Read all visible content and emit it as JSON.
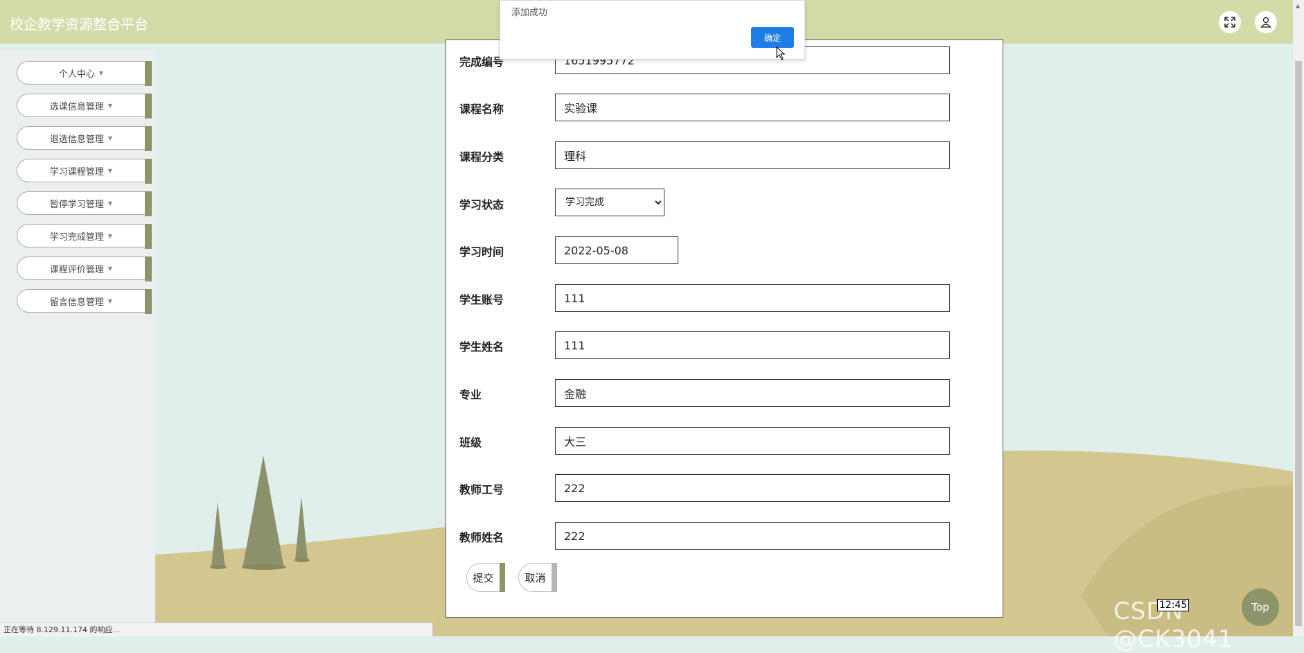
{
  "header": {
    "brand": "校企教学资源整合平台",
    "fullscreen_icon": "expand-arrows-icon",
    "user_icon": "user-icon"
  },
  "sidebar": {
    "items": [
      {
        "label": "个人中心"
      },
      {
        "label": "选课信息管理"
      },
      {
        "label": "退选信息管理"
      },
      {
        "label": "学习课程管理"
      },
      {
        "label": "暂停学习管理"
      },
      {
        "label": "学习完成管理"
      },
      {
        "label": "课程评价管理"
      },
      {
        "label": "留言信息管理"
      }
    ],
    "caret": "▼"
  },
  "form": {
    "completion_no": {
      "label": "完成编号",
      "value": "1651995772"
    },
    "course_name": {
      "label": "课程名称",
      "value": "实验课"
    },
    "course_category": {
      "label": "课程分类",
      "value": "理科"
    },
    "study_status": {
      "label": "学习状态",
      "value": "学习完成"
    },
    "study_time": {
      "label": "学习时间",
      "value": "2022-05-08"
    },
    "student_account": {
      "label": "学生账号",
      "value": "111"
    },
    "student_name": {
      "label": "学生姓名",
      "value": "111"
    },
    "major": {
      "label": "专业",
      "value": "金融"
    },
    "class": {
      "label": "班级",
      "value": "大三"
    },
    "teacher_no": {
      "label": "教师工号",
      "value": "222"
    },
    "teacher_name": {
      "label": "教师姓名",
      "value": "222"
    },
    "submit_label": "提交",
    "cancel_label": "取消"
  },
  "toast": {
    "message": "添加成功",
    "ok_label": "确定"
  },
  "statusbar": {
    "text": "正在等待 8.129.11.174 的响应..."
  },
  "overlay": {
    "top_label": "Top",
    "clock": "12:45",
    "watermark": "CSDN @CK3041"
  },
  "colors": {
    "header_bg": "#d3dca8",
    "accent_olive": "#8c946a",
    "ok_button": "#1e7ee6"
  }
}
